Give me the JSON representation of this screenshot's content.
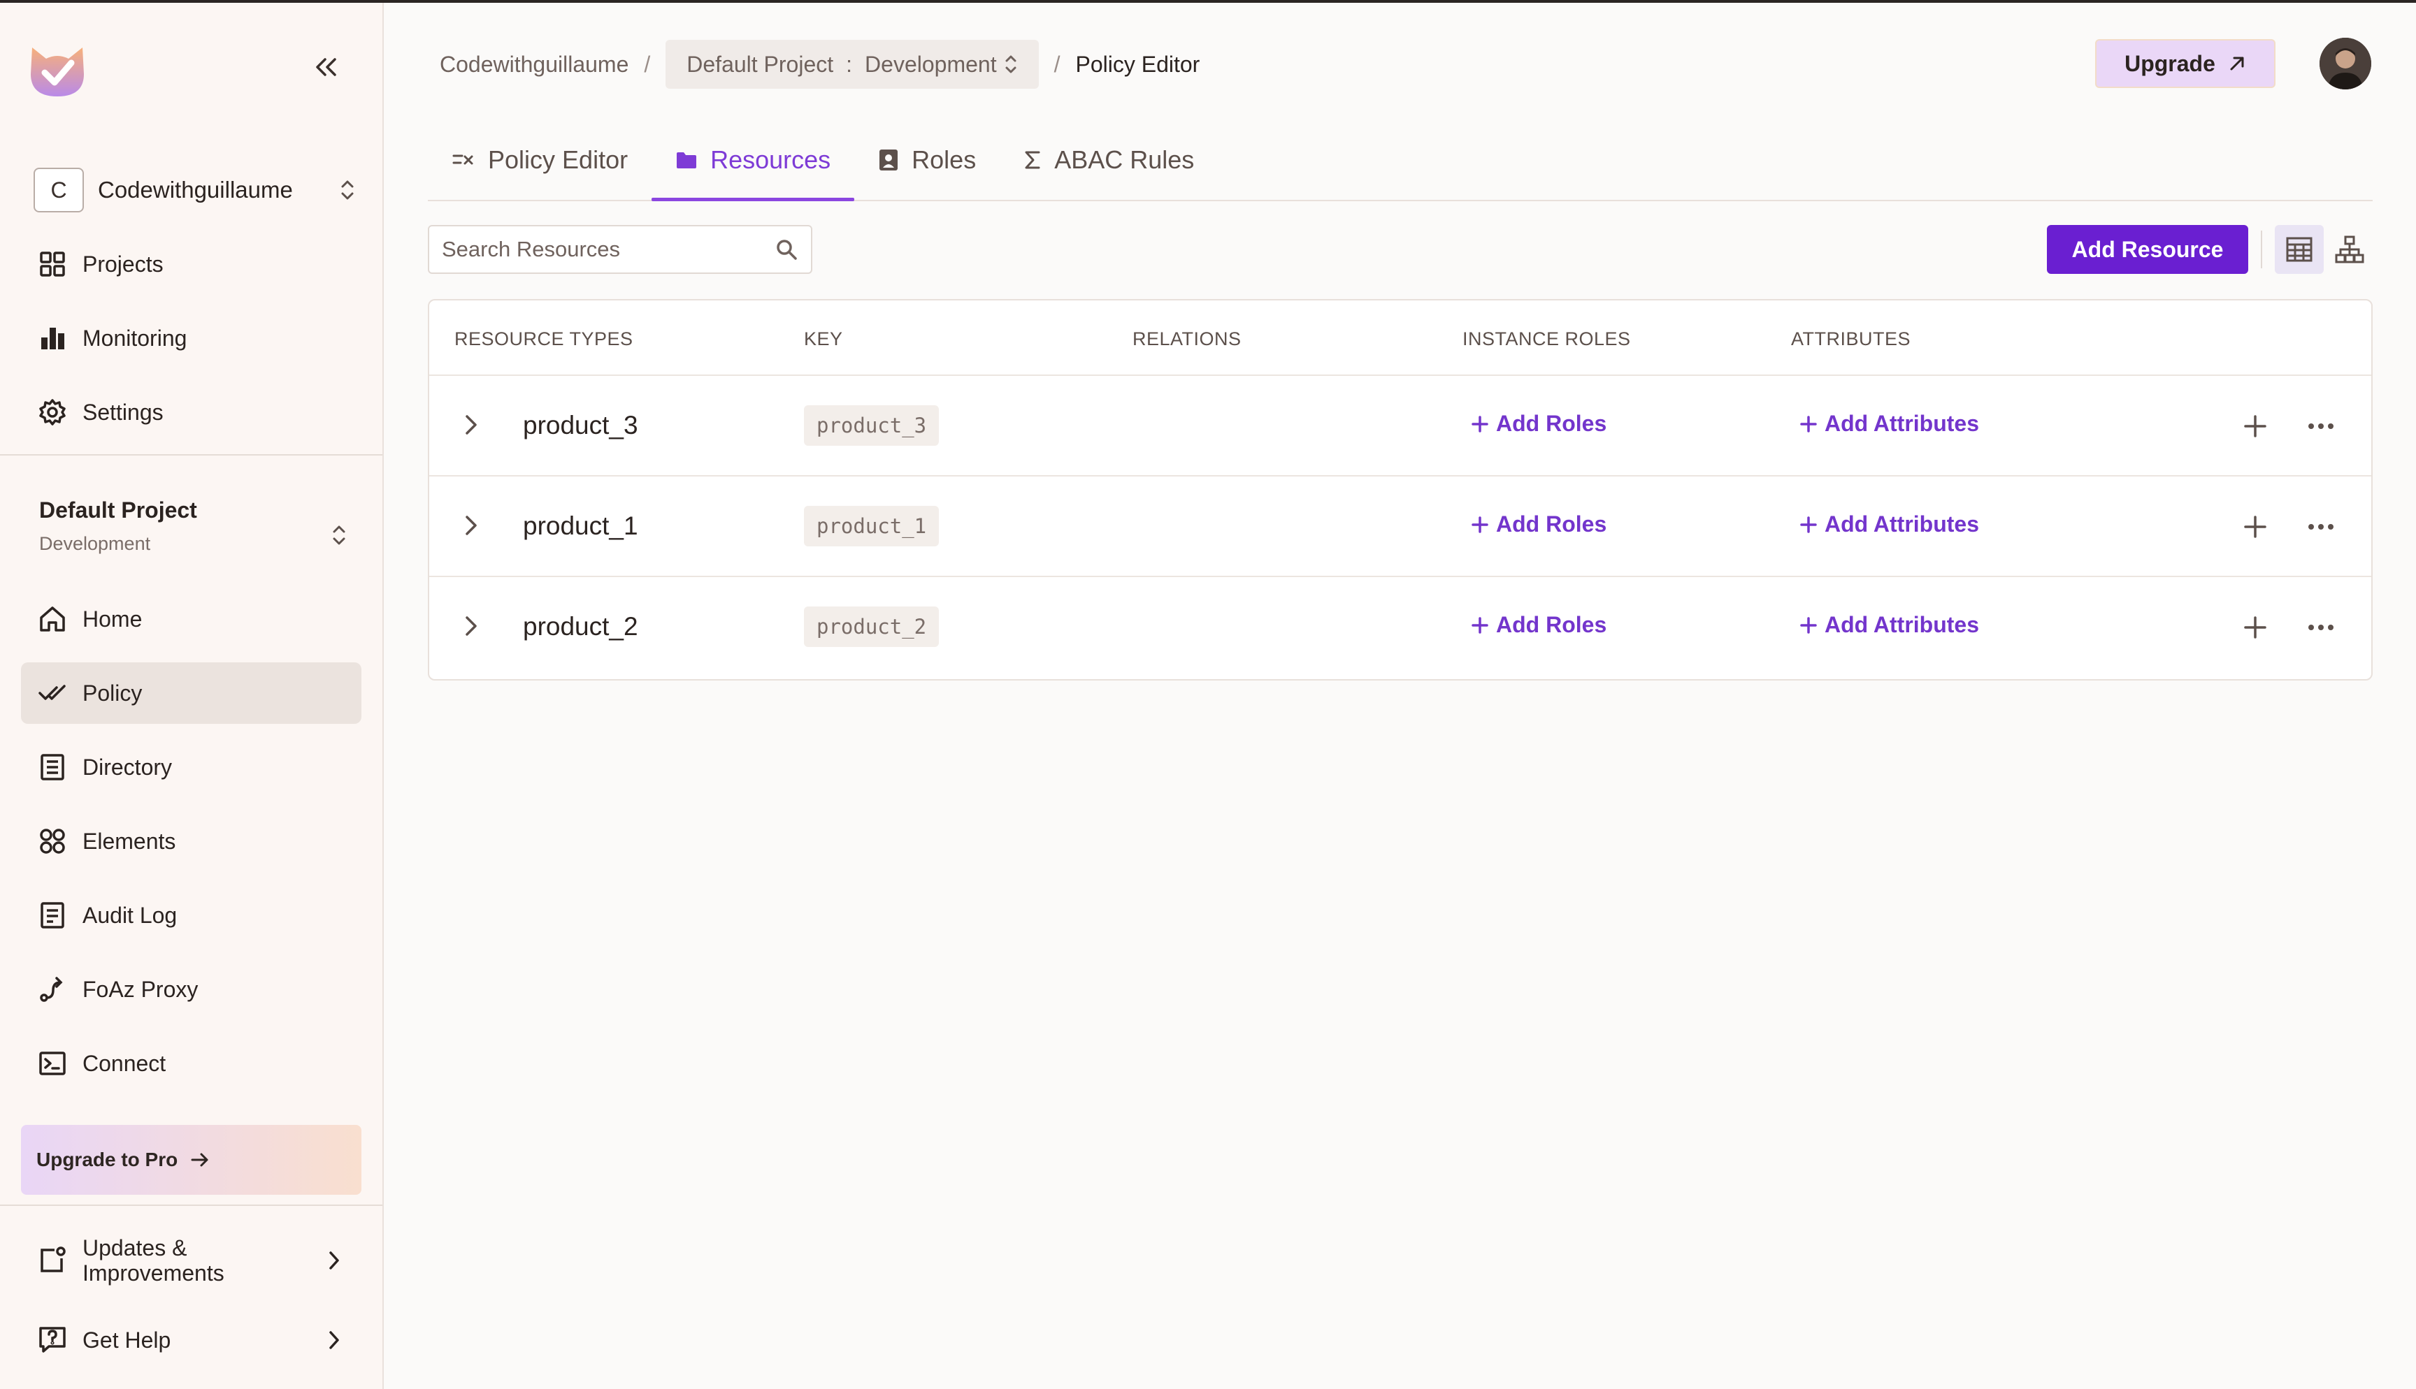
{
  "sidebar": {
    "org": {
      "initial": "C",
      "name": "Codewithguillaume"
    },
    "top_nav": [
      {
        "label": "Projects",
        "icon": "grid-icon"
      },
      {
        "label": "Monitoring",
        "icon": "bar-chart-icon"
      },
      {
        "label": "Settings",
        "icon": "gear-icon"
      }
    ],
    "project": {
      "name": "Default Project",
      "env": "Development"
    },
    "project_nav": [
      {
        "label": "Home",
        "icon": "home-icon"
      },
      {
        "label": "Policy",
        "icon": "double-check-icon",
        "active": true
      },
      {
        "label": "Directory",
        "icon": "directory-icon"
      },
      {
        "label": "Elements",
        "icon": "elements-icon"
      },
      {
        "label": "Audit Log",
        "icon": "document-icon"
      },
      {
        "label": "FoAz Proxy",
        "icon": "proxy-icon"
      },
      {
        "label": "Connect",
        "icon": "terminal-icon"
      }
    ],
    "upgrade_pro": "Upgrade to Pro",
    "updates": "Updates & Improvements",
    "help": "Get Help"
  },
  "header": {
    "breadcrumb": {
      "org": "Codewithguillaume",
      "separator": "/",
      "project": "Default Project",
      "colon": ":",
      "env": "Development",
      "current": "Policy Editor"
    },
    "upgrade": "Upgrade"
  },
  "tabs": [
    {
      "label": "Policy Editor",
      "icon": "policy-editor-icon"
    },
    {
      "label": "Resources",
      "icon": "folder-icon",
      "active": true
    },
    {
      "label": "Roles",
      "icon": "badge-icon"
    },
    {
      "label": "ABAC Rules",
      "icon": "sigma-icon"
    }
  ],
  "search": {
    "placeholder": "Search Resources"
  },
  "toolbar": {
    "add_resource": "Add Resource"
  },
  "table": {
    "columns": [
      "RESOURCE TYPES",
      "KEY",
      "RELATIONS",
      "INSTANCE ROLES",
      "ATTRIBUTES"
    ],
    "rows": [
      {
        "name": "product_3",
        "key": "product_3",
        "roles_action": "Add Roles",
        "attrs_action": "Add Attributes"
      },
      {
        "name": "product_1",
        "key": "product_1",
        "roles_action": "Add Roles",
        "attrs_action": "Add Attributes"
      },
      {
        "name": "product_2",
        "key": "product_2",
        "roles_action": "Add Roles",
        "attrs_action": "Add Attributes"
      }
    ]
  },
  "colors": {
    "accent": "#6a1fd1",
    "accent_text": "#7335cc",
    "sidebar_bg": "#fcf6f3",
    "active_nav": "#ebe3de"
  }
}
